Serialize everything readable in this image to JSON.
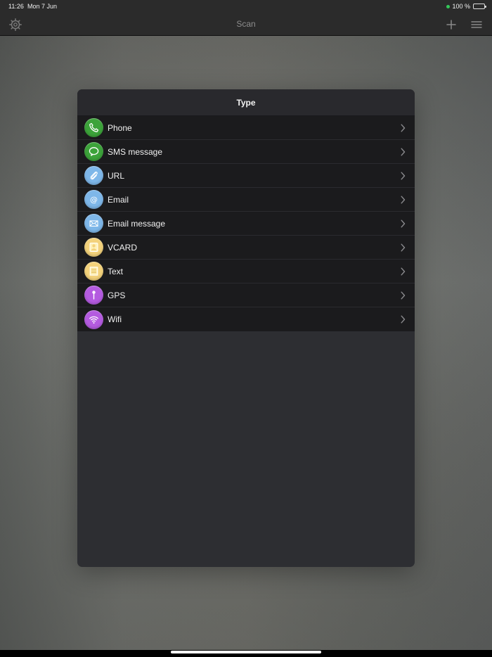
{
  "status_bar": {
    "time": "11:26",
    "date": "Mon 7 Jun",
    "battery_text": "100 %"
  },
  "navbar": {
    "title": "Scan",
    "left_icon": "gear-icon",
    "right_icons": [
      "plus-icon",
      "hamburger-menu-icon"
    ]
  },
  "modal": {
    "title": "Type",
    "items": [
      {
        "label": "Phone",
        "icon": "phone-icon",
        "color": "#3ca33a"
      },
      {
        "label": "SMS message",
        "icon": "speech-bubble-icon",
        "color": "#3ca33a"
      },
      {
        "label": "URL",
        "icon": "paperclip-icon",
        "color": "#7eb7e9"
      },
      {
        "label": "Email",
        "icon": "at-sign-icon",
        "color": "#7eb7e9"
      },
      {
        "label": "Email message",
        "icon": "envelope-icon",
        "color": "#7eb7e9"
      },
      {
        "label": "VCARD",
        "icon": "contact-card-icon",
        "color": "#f3d27b"
      },
      {
        "label": "Text",
        "icon": "text-note-icon",
        "color": "#f3d27b"
      },
      {
        "label": "GPS",
        "icon": "map-pin-icon",
        "color": "#b45be0"
      },
      {
        "label": "Wifi",
        "icon": "wifi-icon",
        "color": "#b45be0"
      }
    ]
  }
}
